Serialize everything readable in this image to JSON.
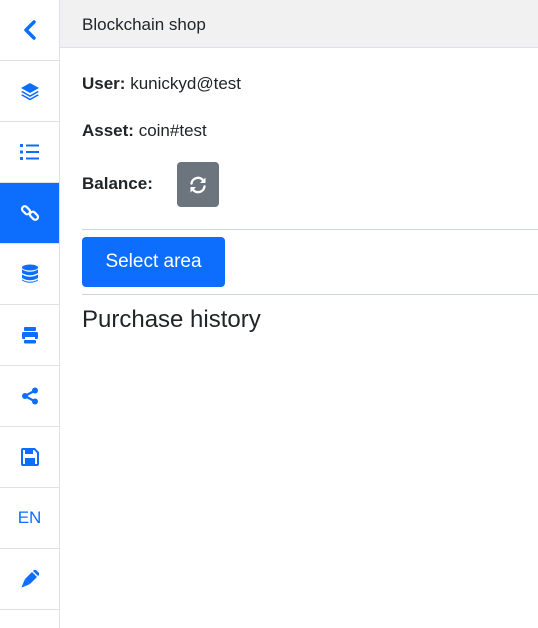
{
  "sidebar": {
    "items": [
      {
        "icon": "chevron-left-icon",
        "active": false
      },
      {
        "icon": "layers-icon",
        "active": false
      },
      {
        "icon": "list-icon",
        "active": false
      },
      {
        "icon": "link-icon",
        "active": true
      },
      {
        "icon": "database-icon",
        "active": false
      },
      {
        "icon": "printer-icon",
        "active": false
      },
      {
        "icon": "share-icon",
        "active": false
      },
      {
        "icon": "save-icon",
        "active": false
      },
      {
        "icon": "language",
        "label": "EN",
        "active": false
      },
      {
        "icon": "pencil-icon",
        "active": false
      }
    ]
  },
  "header": {
    "title": "Blockchain shop"
  },
  "info": {
    "user_label": "User:",
    "user_value": "kunickyd@test",
    "asset_label": "Asset:",
    "asset_value": "coin#test",
    "balance_label": "Balance:",
    "refresh_icon": "refresh-icon"
  },
  "actions": {
    "select_area_label": "Select area"
  },
  "history": {
    "title": "Purchase history"
  },
  "colors": {
    "accent": "#0d6efd",
    "secondary": "#6c757d",
    "header_bg": "#f1f1f1",
    "border": "#dee2e6"
  }
}
